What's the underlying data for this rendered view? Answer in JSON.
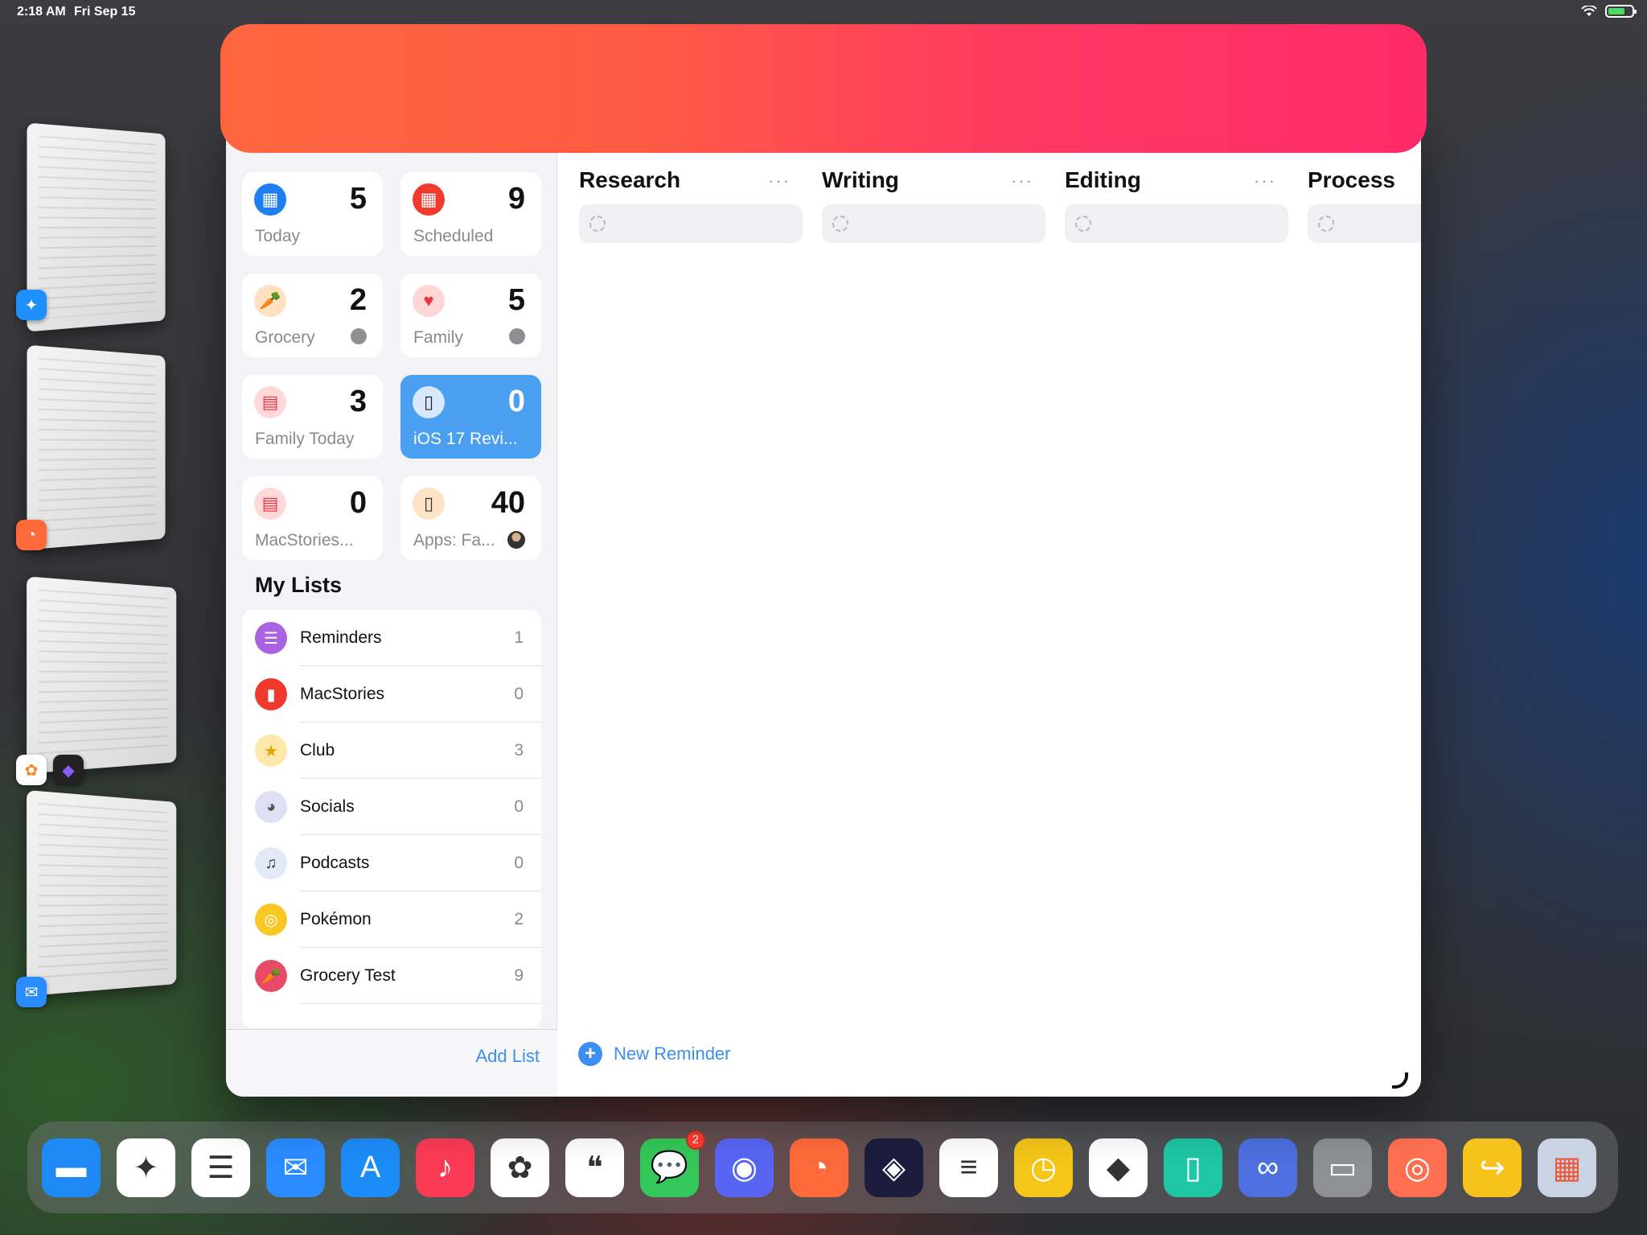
{
  "status_bar": {
    "time": "2:18 AM",
    "date": "Fri Sep 15"
  },
  "stage_manager": [
    {
      "app": "Safari",
      "icon": "safari-icon",
      "color": "#1e8fff"
    },
    {
      "app": "Timery",
      "icon": "timer-icon",
      "color": "#ff6a3a"
    },
    {
      "app": "Photos + Obsidian",
      "icon": "photos-icon",
      "color": "#ffffff"
    },
    {
      "app": "Mail",
      "icon": "mail-icon",
      "color": "#2a8cff"
    }
  ],
  "smart_lists": [
    {
      "label": "Today",
      "count": "5",
      "icon": "calendar-today-icon",
      "color": "#1f7ef0"
    },
    {
      "label": "Scheduled",
      "count": "9",
      "icon": "calendar-scheduled-icon",
      "color": "#f03a2e"
    },
    {
      "label": "Grocery",
      "count": "2",
      "icon": "carrot-icon",
      "color": "#ffe1c2"
    },
    {
      "label": "Family",
      "count": "5",
      "icon": "heart-icon",
      "color": "#ffd6d6"
    },
    {
      "label": "Family Today",
      "count": "3",
      "icon": "family-calendar-icon",
      "color": "#ffd9d9"
    },
    {
      "label": "iOS 17 Revi...",
      "count": "0",
      "icon": "iphone-icon",
      "color": "#d8e9ff"
    },
    {
      "label": "MacStories...",
      "count": "0",
      "icon": "calendar-17-icon",
      "color": "#ffd9d9"
    },
    {
      "label": "Apps: Fa...",
      "count": "40",
      "icon": "phone-apps-icon",
      "color": "#fde3c6"
    }
  ],
  "my_lists_title": "My Lists",
  "lists": [
    {
      "name": "Reminders",
      "count": "1",
      "icon": "list-bullet-icon",
      "color": "#a963e0"
    },
    {
      "name": "MacStories",
      "count": "0",
      "icon": "bookmark-icon",
      "color": "#f0392c"
    },
    {
      "name": "Club",
      "count": "3",
      "icon": "star-icon",
      "color": "#fde7a9"
    },
    {
      "name": "Socials",
      "count": "0",
      "icon": "elephant-icon",
      "color": "#e0e0f5"
    },
    {
      "name": "Podcasts",
      "count": "0",
      "icon": "microphone-icon",
      "color": "#e2eaf5"
    },
    {
      "name": "Pokémon",
      "count": "2",
      "icon": "gamecontroller-icon",
      "color": "#f9c824"
    },
    {
      "name": "Grocery Test",
      "count": "9",
      "icon": "carrot-icon",
      "color": "#e94a68"
    }
  ],
  "add_list_label": "Add List",
  "columns": [
    {
      "title": "Research",
      "more": "···"
    },
    {
      "title": "Writing",
      "more": "···"
    },
    {
      "title": "Editing",
      "more": "···"
    },
    {
      "title": "Process",
      "more": ""
    }
  ],
  "new_reminder_label": "New Reminder",
  "dock": [
    {
      "name": "Files",
      "icon": "folder-icon",
      "color": "#1e88f5"
    },
    {
      "name": "Safari",
      "icon": "safari-icon",
      "color": "#ffffff"
    },
    {
      "name": "Reminders",
      "icon": "reminders-icon",
      "color": "#ffffff"
    },
    {
      "name": "Mail",
      "icon": "mail-icon",
      "color": "#2a8cff"
    },
    {
      "name": "App Store",
      "icon": "appstore-icon",
      "color": "#1c8cf8"
    },
    {
      "name": "Music",
      "icon": "music-icon",
      "color": "#fb3a55"
    },
    {
      "name": "Photos",
      "icon": "photos-icon",
      "color": "#ffffff"
    },
    {
      "name": "Quotes",
      "icon": "quote-icon",
      "color": "#ffffff"
    },
    {
      "name": "Messages",
      "icon": "messages-icon",
      "color": "#34c759",
      "badge": "2"
    },
    {
      "name": "Discord",
      "icon": "discord-icon",
      "color": "#5865f2"
    },
    {
      "name": "Timery",
      "icon": "timer-icon",
      "color": "#ff6a3a"
    },
    {
      "name": "Shortcuts",
      "icon": "shortcuts-icon",
      "color": "#1c1c3e"
    },
    {
      "name": "Notes",
      "icon": "notes-icon",
      "color": "#ffffff"
    },
    {
      "name": "Clock",
      "icon": "clock-icon",
      "color": "#f5c518"
    },
    {
      "name": "Obsidian",
      "icon": "obsidian-icon",
      "color": "#ffffff"
    },
    {
      "name": "Sidecar",
      "icon": "tablet-icon",
      "color": "#1fc6a6"
    },
    {
      "name": "Link",
      "icon": "link-icon",
      "color": "#4e6fe0"
    },
    {
      "name": "Display",
      "icon": "display-icon",
      "color": "#8e9095"
    },
    {
      "name": "Broadcast",
      "icon": "broadcast-icon",
      "color": "#ff7052"
    },
    {
      "name": "Forward",
      "icon": "forward-icon",
      "color": "#f6c31c"
    },
    {
      "name": "App Library",
      "icon": "app-library-icon",
      "color": "#c9d3e3"
    }
  ]
}
